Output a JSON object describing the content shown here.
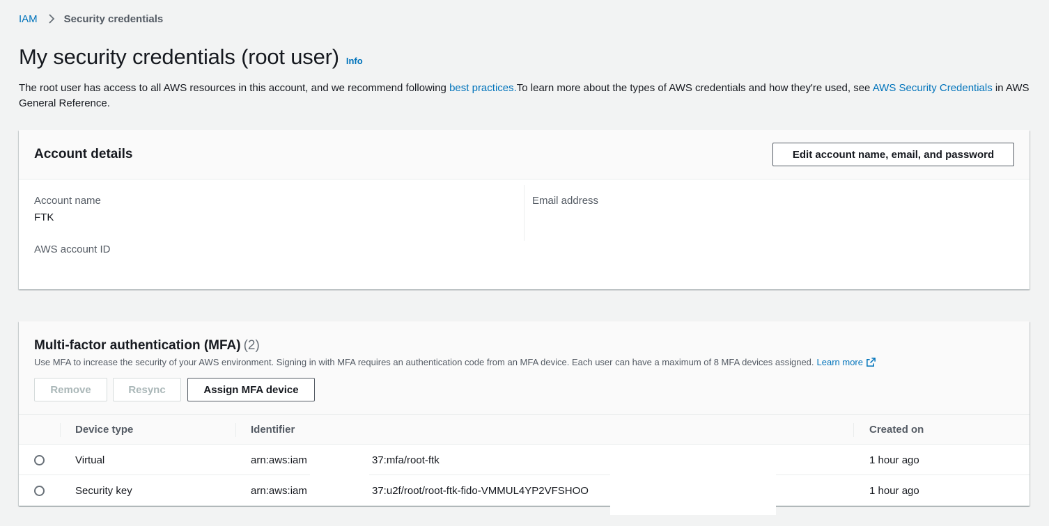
{
  "breadcrumb": {
    "root": "IAM",
    "current": "Security credentials"
  },
  "title": "My security credentials (root user)",
  "info_label": "Info",
  "intro": {
    "part1": "The root user has access to all AWS resources in this account, and we recommend following ",
    "link1": "best practices.",
    "part2": "To learn more about the types of AWS credentials and how they're used, see ",
    "link2": "AWS Security Credentials",
    "part3": " in AWS General Reference."
  },
  "account": {
    "title": "Account details",
    "edit_button": "Edit account name, email, and password",
    "name_label": "Account name",
    "name_value": "FTK",
    "email_label": "Email address",
    "id_label": "AWS account ID"
  },
  "mfa": {
    "title": "Multi-factor authentication (MFA)",
    "count": "(2)",
    "description": "Use MFA to increase the security of your AWS environment. Signing in with MFA requires an authentication code from an MFA device. Each user can have a maximum of 8 MFA devices assigned.",
    "learn_more": "Learn more",
    "buttons": {
      "remove": "Remove",
      "resync": "Resync",
      "assign": "Assign MFA device"
    },
    "columns": {
      "device_type": "Device type",
      "identifier": "Identifier",
      "created_on": "Created on"
    },
    "rows": [
      {
        "device_type": "Virtual",
        "id_prefix": "arn:aws:iam",
        "id_suffix": "37:mfa/root-ftk",
        "created_on": "1 hour ago"
      },
      {
        "device_type": "Security key",
        "id_prefix": "arn:aws:iam",
        "id_suffix": "37:u2f/root/root-ftk-fido-VMMUL4YP2VFSHOO",
        "created_on": "1 hour ago"
      }
    ]
  },
  "colors": {
    "link": "#0073bb",
    "text": "#16191f",
    "secondary": "#545b64",
    "background": "#f2f3f3"
  }
}
